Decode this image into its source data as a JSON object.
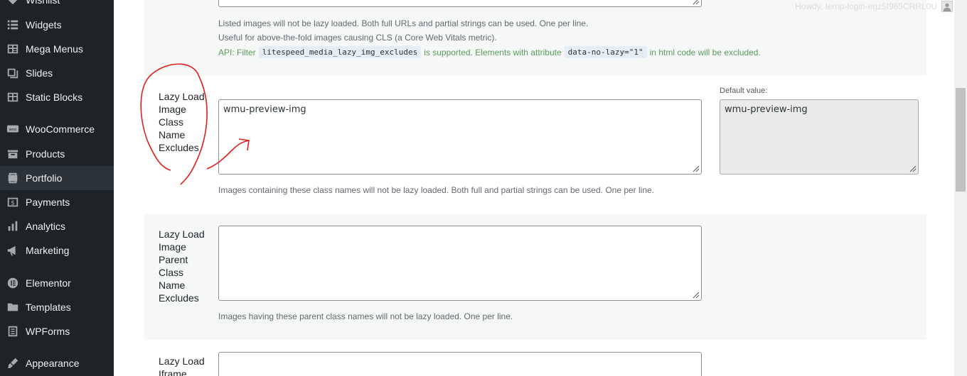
{
  "sidebar": {
    "items": [
      {
        "label": "Wishlist",
        "icon": "heart-icon"
      },
      {
        "label": "Widgets",
        "icon": "widgets-icon"
      },
      {
        "label": "Mega Menus",
        "icon": "menu-icon"
      },
      {
        "label": "Slides",
        "icon": "slides-icon"
      },
      {
        "label": "Static Blocks",
        "icon": "blocks-icon"
      },
      {
        "label": "WooCommerce",
        "icon": "woocommerce-icon"
      },
      {
        "label": "Products",
        "icon": "products-icon"
      },
      {
        "label": "Portfolio",
        "icon": "portfolio-icon"
      },
      {
        "label": "Payments",
        "icon": "payments-icon"
      },
      {
        "label": "Analytics",
        "icon": "analytics-icon"
      },
      {
        "label": "Marketing",
        "icon": "marketing-icon"
      },
      {
        "label": "Elementor",
        "icon": "elementor-icon"
      },
      {
        "label": "Templates",
        "icon": "templates-icon"
      },
      {
        "label": "WPForms",
        "icon": "wpforms-icon"
      },
      {
        "label": "Appearance",
        "icon": "appearance-icon"
      }
    ]
  },
  "top": {
    "howdy": "Howdy, temp-login-egz5f965CRRL0U"
  },
  "sections": {
    "first": {
      "desc1": "Listed images will not be lazy loaded. Both full URLs and partial strings can be used. One per line.",
      "desc2": "Useful for above-the-fold images causing CLS (a Core Web Vitals metric).",
      "api_prefix": "API: Filter",
      "api_filter": "litespeed_media_lazy_img_excludes",
      "api_mid": "is supported. Elements with attribute",
      "api_attr": "data-no-lazy=\"1\"",
      "api_suffix": "in html code will be excluded."
    },
    "class_excludes": {
      "label": "Lazy Load Image Class Name Excludes",
      "value": "wmu-preview-img",
      "default_label": "Default value:",
      "default_value": "wmu-preview-img",
      "desc": "Images containing these class names will not be lazy loaded. Both full and partial strings can be used. One per line."
    },
    "parent_class_excludes": {
      "label": "Lazy Load Image Parent Class Name Excludes",
      "value": "",
      "desc": "Images having these parent class names will not be lazy loaded. One per line."
    },
    "iframe": {
      "label": "Lazy Load Iframe"
    }
  },
  "colors": {
    "sidebar_bg": "#1d2327",
    "annotation": "#e0201e",
    "api_text": "#5a9c5a"
  }
}
